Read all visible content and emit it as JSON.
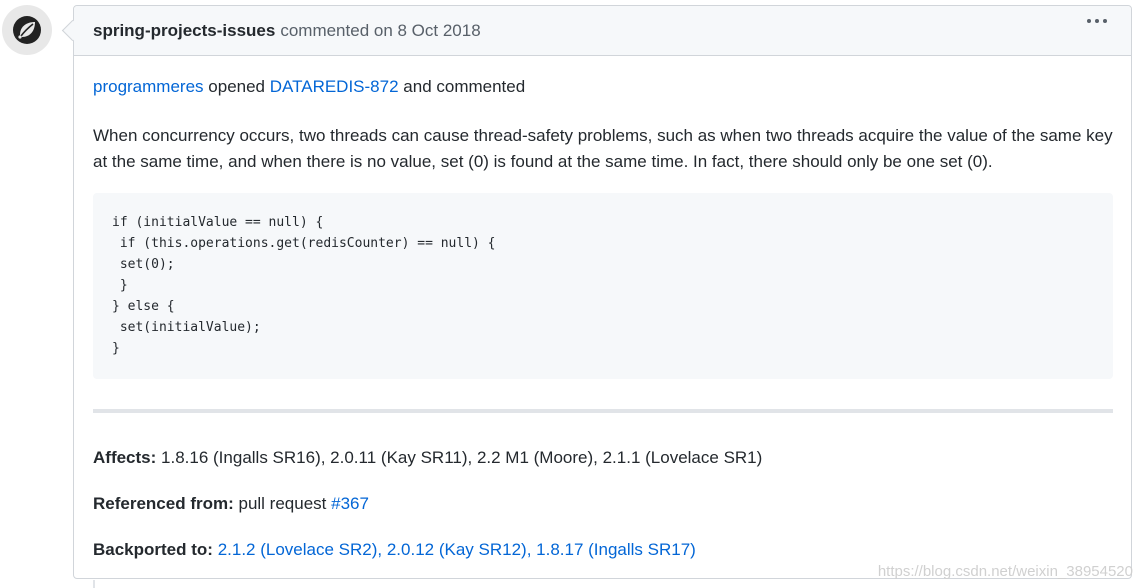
{
  "header": {
    "author": "spring-projects-issues",
    "action": "commented on 8 Oct 2018",
    "menu_icon": "kebab-horizontal-icon"
  },
  "avatar": {
    "icon": "spring-leaf-logo",
    "color": "#222222"
  },
  "body": {
    "opener": "programmeres",
    "opened_text": "opened",
    "issue_key": "DATAREDIS-872",
    "and_commented": "and commented",
    "description": "When concurrency occurs, two threads can cause thread-safety problems, such as when two threads acquire the value of the same key at the same time, and when there is no value, set (0) is found at the same time. In fact, there should only be one set (0).",
    "code": "if (initialValue == null) {\n if (this.operations.get(redisCounter) == null) {\n set(0);\n }\n} else {\n set(initialValue);\n}"
  },
  "meta": {
    "affects_label": "Affects:",
    "affects_value": "1.8.16 (Ingalls SR16), 2.0.11 (Kay SR11), 2.2 M1 (Moore), 2.1.1 (Lovelace SR1)",
    "referenced_label": "Referenced from:",
    "referenced_text": "pull request",
    "referenced_link": "#367",
    "backported_label": "Backported to:",
    "backported_value": "2.1.2 (Lovelace SR2), 2.0.12 (Kay SR12), 1.8.17 (Ingalls SR17)"
  },
  "watermark": "https://blog.csdn.net/weixin_38954520",
  "colors": {
    "link": "#0366d6",
    "header_bg": "#f6f8fa",
    "border": "#d1d5da"
  }
}
